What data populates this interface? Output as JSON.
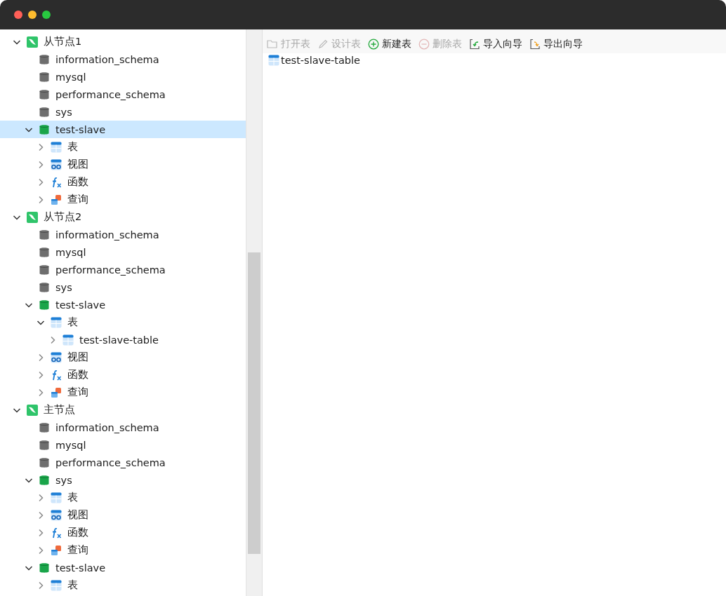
{
  "toolbar": [
    {
      "kind": "open",
      "label": "打开表",
      "disabled": true
    },
    {
      "kind": "design",
      "label": "设计表",
      "disabled": true
    },
    {
      "kind": "new",
      "label": "新建表",
      "disabled": false
    },
    {
      "kind": "delete",
      "label": "删除表",
      "disabled": true
    },
    {
      "kind": "import",
      "label": "导入向导",
      "disabled": false
    },
    {
      "kind": "export",
      "label": "导出向导",
      "disabled": false
    }
  ],
  "objects": [
    {
      "kind": "table",
      "label": "test-slave-table"
    }
  ],
  "tree": [
    {
      "kind": "connection",
      "label": "从节点1",
      "expanded": true,
      "selected": false,
      "children": [
        {
          "kind": "database",
          "label": "information_schema",
          "open": false,
          "selected": false
        },
        {
          "kind": "database",
          "label": "mysql",
          "open": false,
          "selected": false
        },
        {
          "kind": "database",
          "label": "performance_schema",
          "open": false,
          "selected": false
        },
        {
          "kind": "database",
          "label": "sys",
          "open": false,
          "selected": false
        },
        {
          "kind": "database",
          "label": "test-slave",
          "open": true,
          "expanded": true,
          "selected": true,
          "children": [
            {
              "kind": "tables",
              "label": "表",
              "expanded": false,
              "selected": false
            },
            {
              "kind": "views",
              "label": "视图",
              "expanded": false,
              "selected": false
            },
            {
              "kind": "functions",
              "label": "函数",
              "expanded": false,
              "selected": false
            },
            {
              "kind": "queries",
              "label": "查询",
              "expanded": false,
              "selected": false
            }
          ]
        }
      ]
    },
    {
      "kind": "connection",
      "label": "从节点2",
      "expanded": true,
      "selected": false,
      "children": [
        {
          "kind": "database",
          "label": "information_schema",
          "open": false,
          "selected": false
        },
        {
          "kind": "database",
          "label": "mysql",
          "open": false,
          "selected": false
        },
        {
          "kind": "database",
          "label": "performance_schema",
          "open": false,
          "selected": false
        },
        {
          "kind": "database",
          "label": "sys",
          "open": false,
          "selected": false
        },
        {
          "kind": "database",
          "label": "test-slave",
          "open": true,
          "expanded": true,
          "selected": false,
          "children": [
            {
              "kind": "tables",
              "label": "表",
              "expanded": true,
              "selected": false,
              "children": [
                {
                  "kind": "table",
                  "label": "test-slave-table",
                  "expanded": false,
                  "selected": false
                }
              ]
            },
            {
              "kind": "views",
              "label": "视图",
              "expanded": false,
              "selected": false
            },
            {
              "kind": "functions",
              "label": "函数",
              "expanded": false,
              "selected": false
            },
            {
              "kind": "queries",
              "label": "查询",
              "expanded": false,
              "selected": false
            }
          ]
        }
      ]
    },
    {
      "kind": "connection",
      "label": "主节点",
      "expanded": true,
      "selected": false,
      "children": [
        {
          "kind": "database",
          "label": "information_schema",
          "open": false,
          "selected": false
        },
        {
          "kind": "database",
          "label": "mysql",
          "open": false,
          "selected": false
        },
        {
          "kind": "database",
          "label": "performance_schema",
          "open": false,
          "selected": false
        },
        {
          "kind": "database",
          "label": "sys",
          "open": true,
          "expanded": true,
          "selected": false,
          "children": [
            {
              "kind": "tables",
              "label": "表",
              "expanded": false,
              "selected": false
            },
            {
              "kind": "views",
              "label": "视图",
              "expanded": false,
              "selected": false
            },
            {
              "kind": "functions",
              "label": "函数",
              "expanded": false,
              "selected": false
            },
            {
              "kind": "queries",
              "label": "查询",
              "expanded": false,
              "selected": false
            }
          ]
        },
        {
          "kind": "database",
          "label": "test-slave",
          "open": true,
          "expanded": true,
          "selected": false,
          "children": [
            {
              "kind": "tables",
              "label": "表",
              "expanded": false,
              "selected": false
            }
          ]
        }
      ]
    }
  ]
}
